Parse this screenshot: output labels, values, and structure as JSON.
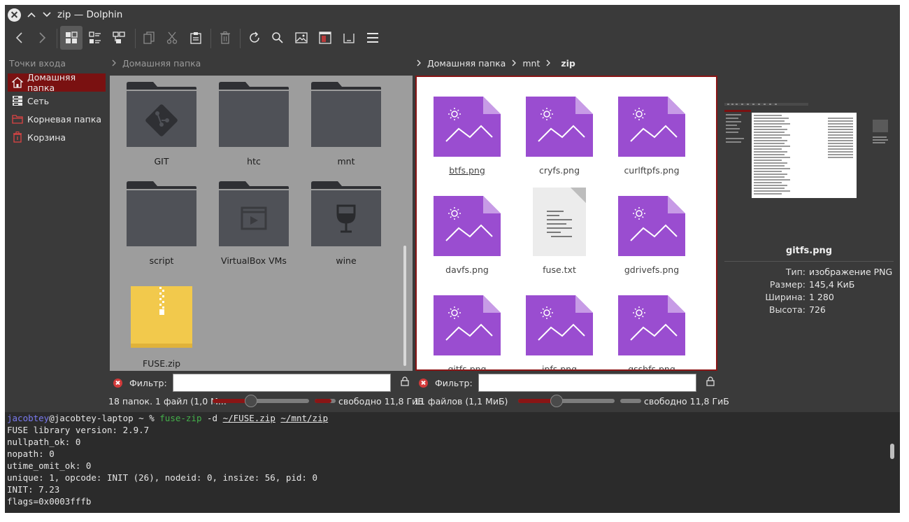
{
  "window": {
    "title": "zip — Dolphin"
  },
  "places": {
    "title": "Точки входа",
    "items": [
      {
        "label": "Домашняя папка",
        "icon": "home-icon",
        "active": true
      },
      {
        "label": "Сеть",
        "icon": "network-icon",
        "active": false
      },
      {
        "label": "Корневая папка",
        "icon": "root-folder-icon",
        "active": false
      },
      {
        "label": "Корзина",
        "icon": "trash-icon",
        "active": false
      }
    ]
  },
  "left_pane": {
    "breadcrumb": [
      "Домашняя папка"
    ],
    "items": [
      {
        "name": "GIT",
        "icon": "git-folder-icon"
      },
      {
        "name": "htc",
        "icon": "folder-icon"
      },
      {
        "name": "mnt",
        "icon": "folder-icon"
      },
      {
        "name": "script",
        "icon": "folder-icon"
      },
      {
        "name": "VirtualBox VMs",
        "icon": "virtualbox-folder-icon"
      },
      {
        "name": "wine",
        "icon": "wine-folder-icon"
      },
      {
        "name": "FUSE.zip",
        "icon": "zip-file-icon"
      }
    ],
    "filter_label": "Фильтр:",
    "filter_value": "",
    "status": "18 папок. 1 файл (1,0 М...",
    "free": "свободно 11,8 ГиБ",
    "zoom_level": 0.4
  },
  "right_pane": {
    "breadcrumb": [
      "Домашняя папка",
      "mnt",
      "zip"
    ],
    "items": [
      {
        "name": "btfs.png",
        "icon": "image-file-icon"
      },
      {
        "name": "cryfs.png",
        "icon": "image-file-icon"
      },
      {
        "name": "curlftpfs.png",
        "icon": "image-file-icon"
      },
      {
        "name": "davfs.png",
        "icon": "image-file-icon"
      },
      {
        "name": "fuse.txt",
        "icon": "text-file-icon"
      },
      {
        "name": "gdrivefs.png",
        "icon": "image-file-icon"
      },
      {
        "name": "gitfs.png",
        "icon": "image-file-icon"
      },
      {
        "name": "ipfs.png",
        "icon": "image-file-icon"
      },
      {
        "name": "gsshfs.png",
        "icon": "image-file-icon"
      }
    ],
    "filter_label": "Фильтр:",
    "filter_value": "",
    "status": "11 файлов (1,1 МиБ)",
    "free": "свободно 11,8 ГиБ",
    "zoom_level": 0.4
  },
  "info": {
    "file_name": "gitfs.png",
    "rows": [
      {
        "k": "Тип:",
        "v": "изображение PNG"
      },
      {
        "k": "Размер:",
        "v": "145,4 КиБ"
      },
      {
        "k": "Ширина:",
        "v": "1 280"
      },
      {
        "k": "Высота:",
        "v": "726"
      }
    ]
  },
  "terminal": {
    "user": "jacobtey",
    "host_prompt": "@jacobtey-laptop ~ % ",
    "cmd": "fuse-zip",
    "flag": " -d ",
    "arg1": "~/FUSE.zip",
    "arg2": "~/mnt/zip",
    "lines": [
      "FUSE library version: 2.9.7",
      "nullpath_ok: 0",
      "nopath: 0",
      "utime_omit_ok: 0",
      "unique: 1, opcode: INIT (26), nodeid: 0, insize: 56, pid: 0",
      "INIT: 7.23",
      "flags=0x0003fffb"
    ]
  },
  "colors": {
    "accent": "#8a1515",
    "folder": "#4f5157",
    "image_file": "#9a4dd0",
    "zip_file": "#f2c94c"
  }
}
